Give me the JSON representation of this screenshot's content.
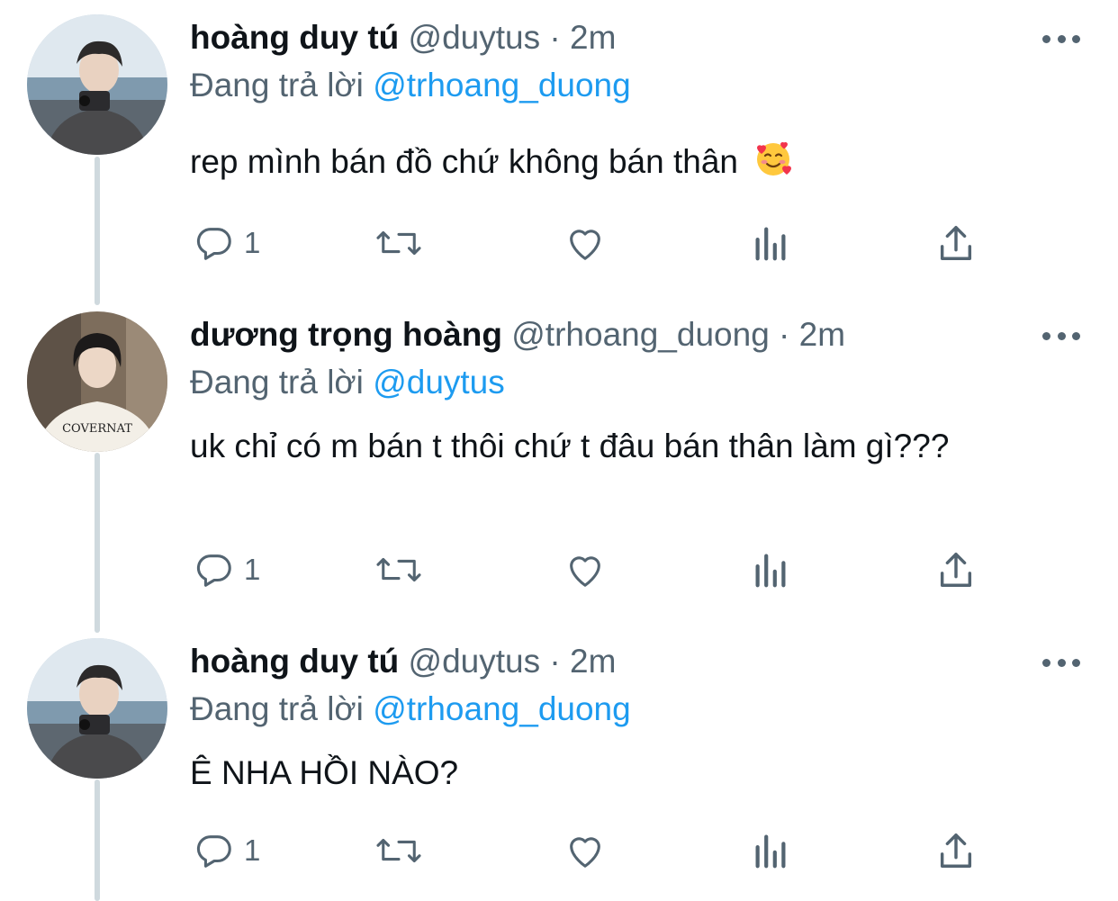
{
  "colors": {
    "text": "#0f1419",
    "secondary": "#536471",
    "link": "#1d9bf0",
    "thread_line": "#cfd9de"
  },
  "tweets": [
    {
      "display_name": "hoàng duy tú",
      "handle": "@duytus",
      "separator": "·",
      "time": "2m",
      "reply_prefix": "Đang trả lời",
      "reply_to": "@trhoang_duong",
      "text": "rep mình bán đồ chứ không bán thân",
      "emoji": "smiling-face-with-hearts",
      "reply_count": "1"
    },
    {
      "display_name": "dương trọng hoàng",
      "handle": "@trhoang_duong",
      "separator": "·",
      "time": "2m",
      "reply_prefix": "Đang trả lời",
      "reply_to": "@duytus",
      "text": "uk chỉ có m bán t thôi chứ t đâu bán thân làm gì???",
      "reply_count": "1",
      "shirt_text": "COVERNAT"
    },
    {
      "display_name": "hoàng duy tú",
      "handle": "@duytus",
      "separator": "·",
      "time": "2m",
      "reply_prefix": "Đang trả lời",
      "reply_to": "@trhoang_duong",
      "text": "Ê NHA HỒI NÀO?",
      "reply_count": "1"
    }
  ],
  "icons": {
    "reply": "speech-bubble-icon",
    "retweet": "retweet-arrows-icon",
    "like": "heart-outline-icon",
    "analytics": "bar-chart-icon",
    "share": "share-upload-icon",
    "more": "more-dots-icon"
  }
}
